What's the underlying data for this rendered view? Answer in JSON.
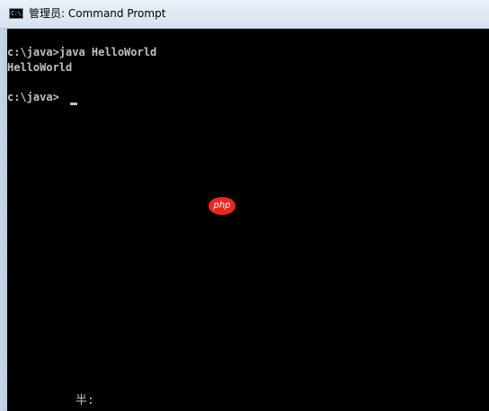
{
  "window": {
    "title": "管理员: Command Prompt",
    "icon": "console-app-icon",
    "icon_label": "C:\\."
  },
  "console": {
    "lines": [
      "c:\\java>java HelloWorld",
      "HelloWorld",
      "c:\\java>"
    ],
    "ime_status": "半:"
  },
  "watermark": {
    "text": "php",
    "color": "#e8271f"
  },
  "colors": {
    "console_background": "#000000",
    "console_text": "#c0c0c0",
    "titlebar": "#dbe6f2"
  }
}
